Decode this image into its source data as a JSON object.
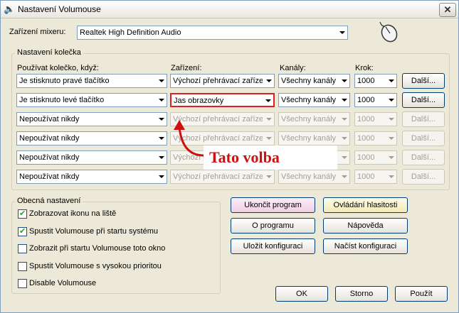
{
  "window": {
    "title": "Nastavení Volumouse",
    "close_glyph": "✕",
    "app_icon": "speaker-icon"
  },
  "mixer": {
    "label": "Zařízení mixeru:",
    "value": "Realtek High Definition Audio"
  },
  "wheel_group": {
    "title": "Nastavení kolečka",
    "col_use": "Používat kolečko, když:",
    "col_device": "Zařízení:",
    "col_channels": "Kanály:",
    "col_step": "Krok:",
    "rows": [
      {
        "use": "Je stisknuto pravé tlačítko",
        "device": "Výchozí přehrávací zaříze",
        "channels": "Všechny kanály",
        "step": "1000",
        "more": "Další...",
        "enabled": true
      },
      {
        "use": "Je stisknuto levé tlačítko",
        "device": "Jas obrazovky",
        "channels": "Všechny kanály",
        "step": "1000",
        "more": "Další...",
        "enabled": true
      },
      {
        "use": "Nepoužívat nikdy",
        "device": "Výchozí přehrávací zaříze",
        "channels": "Všechny kanály",
        "step": "1000",
        "more": "Další...",
        "enabled": false
      },
      {
        "use": "Nepoužívat nikdy",
        "device": "Výchozí přehrávací zaříze",
        "channels": "Všechny kanály",
        "step": "1000",
        "more": "Další...",
        "enabled": false
      },
      {
        "use": "Nepoužívat nikdy",
        "device": "Výchozí přehrávací zaříze",
        "channels": "Všechny kanály",
        "step": "1000",
        "more": "Další...",
        "enabled": false
      },
      {
        "use": "Nepoužívat nikdy",
        "device": "Výchozí přehrávací zaříze",
        "channels": "Všechny kanály",
        "step": "1000",
        "more": "Další...",
        "enabled": false
      }
    ]
  },
  "general_group": {
    "title": "Obecná nastavení",
    "options": [
      {
        "label": "Zobrazovat ikonu na liště",
        "checked": true
      },
      {
        "label": "Spustit Volumouse při startu systému",
        "checked": true
      },
      {
        "label": "Zobrazit při startu Volumouse toto okno",
        "checked": false
      },
      {
        "label": "Spustit Volumouse s vysokou prioritou",
        "checked": false
      },
      {
        "label": "Disable Volumouse",
        "checked": false
      }
    ]
  },
  "actions": {
    "exit": "Ukončit program",
    "volume_control": "Ovládání hlasitosti",
    "about": "O programu",
    "help": "Nápověda",
    "save_config": "Uložit konfiguraci",
    "load_config": "Načíst konfiguraci"
  },
  "footer": {
    "ok": "OK",
    "cancel": "Storno",
    "apply": "Použít"
  },
  "annotation": {
    "text": "Tato volba",
    "color": "#d01010"
  }
}
